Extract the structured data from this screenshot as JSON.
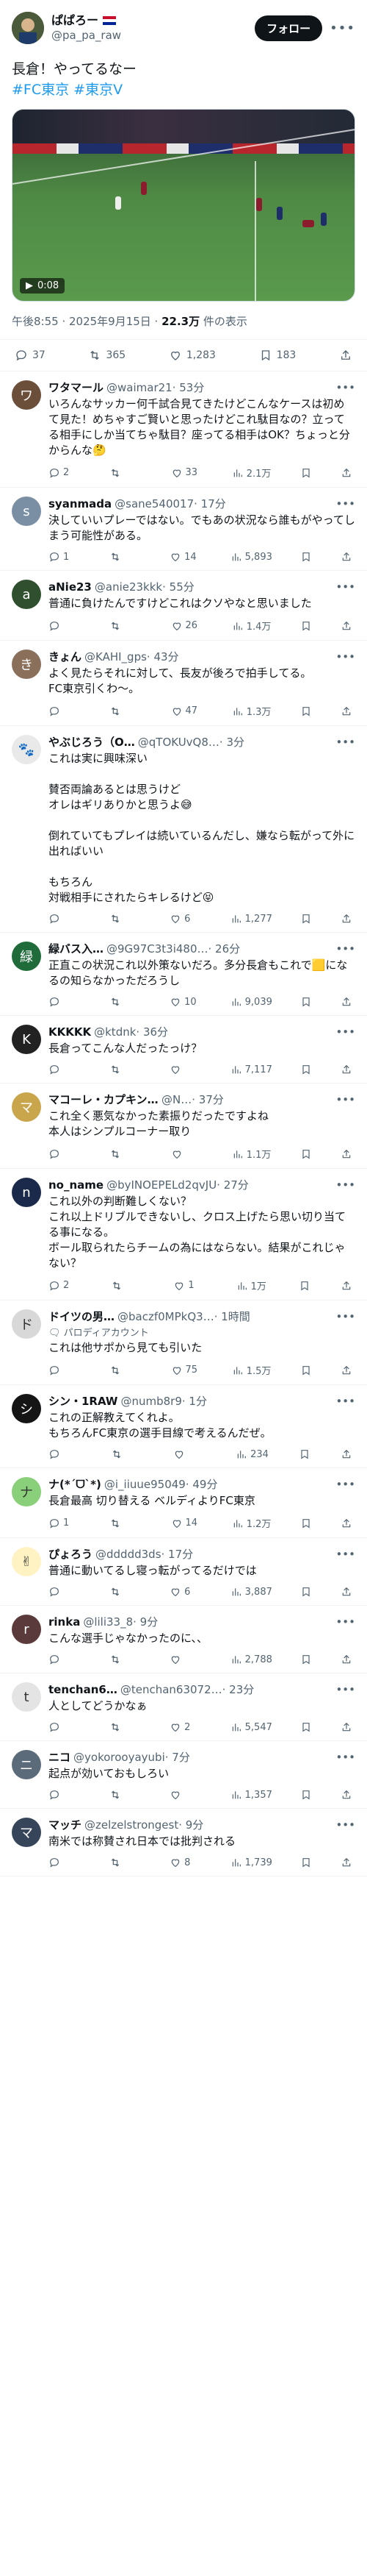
{
  "post": {
    "author_name": "ぱぱろー",
    "author_handle": "@pa_pa_raw",
    "follow_label": "フォロー",
    "text": "長倉！やってるなー",
    "hashtags": "#FC東京 #東京V",
    "video_time": "0:08",
    "timestamp": "午後8:55 · 2025年9月15日 · ",
    "views_count": "22.3万",
    "views_label": " 件の表示",
    "stats": {
      "replies": "37",
      "reposts": "365",
      "likes": "1,283",
      "bookmarks": "183"
    }
  },
  "replies": [
    {
      "name": "ワタマール",
      "handle": "@waimar21",
      "time": "· 53分",
      "text": "いろんなサッカー何千試合見てきたけどこんなケースは初めて見た！めちゃすご賢いと思ったけどこれ駄目なの？立ってる相手にしか当てちゃ駄目？座ってる相手はOK？ちょっと分からんな🤔",
      "replies": "2",
      "reposts": "",
      "likes": "33",
      "views": "2.1万",
      "avatar_color": "#6b4f3a",
      "avatar_char": "ワ"
    },
    {
      "name": "syanmada",
      "handle": "@sane540017",
      "time": "· 17分",
      "text": "決していいプレーではない。でもあの状況なら誰もがやってしまう可能性がある。",
      "replies": "1",
      "reposts": "",
      "likes": "14",
      "views": "5,893",
      "avatar_color": "#7a8fa3",
      "avatar_char": "s"
    },
    {
      "name": "aNie23",
      "handle": "@anie23kkk",
      "time": "· 55分",
      "text": "普通に負けたんですけどこれはクソやなと思いました",
      "replies": "",
      "reposts": "",
      "likes": "26",
      "views": "1.4万",
      "avatar_color": "#2f4f2f",
      "avatar_char": "a"
    },
    {
      "name": "きょん",
      "handle": "@KAHI_gps",
      "time": "· 43分",
      "text": "よく見たらそれに対して、長友が後ろで拍手してる。\nFC東京引くわ〜。",
      "replies": "",
      "reposts": "",
      "likes": "47",
      "views": "1.3万",
      "avatar_color": "#8a6f5a",
      "avatar_char": "き"
    },
    {
      "name": "やぶじろう（O…",
      "handle": "@qTOKUvQ8…",
      "time": "· 3分",
      "text": "これは実に興味深い\n\n賛否両論あるとは思うけど\nオレはギリありかと思うよ😅\n\n倒れていてもプレイは続いているんだし、嫌なら転がって外に出ればいい\n\nもちろん\n対戦相手にされたらキレるけど😝",
      "replies": "",
      "reposts": "",
      "likes": "6",
      "views": "1,277",
      "avatar_color": "#e9e9e9",
      "avatar_char": "🐾"
    },
    {
      "name": "緑バス入…",
      "handle": "@9G97C3t3i480…",
      "time": "· 26分",
      "text": "正直この状況これ以外策ないだろ。多分長倉もこれで🟨になるの知らなかっただろうし",
      "replies": "",
      "reposts": "",
      "likes": "10",
      "views": "9,039",
      "avatar_color": "#1f6b3a",
      "avatar_char": "緑"
    },
    {
      "name": "KKKKK",
      "handle": "@ktdnk",
      "time": "· 36分",
      "text": "長倉ってこんな人だったっけ？",
      "replies": "",
      "reposts": "",
      "likes": "",
      "views": "7,117",
      "avatar_color": "#222222",
      "avatar_char": "K"
    },
    {
      "name": "マコーレ・カプキン@投資…",
      "handle": "@N…",
      "time": "· 37分",
      "text": "これ全く悪気なかった素振りだったですよね\n本人はシンプルコーナー取り",
      "replies": "",
      "reposts": "",
      "likes": "",
      "views": "1.1万",
      "avatar_color": "#c9a64b",
      "avatar_char": "マ"
    },
    {
      "name": "no_name",
      "handle": "@byINOEPELd2qvJU",
      "time": "· 27分",
      "text": "これ以外の判断難しくない？\nこれ以上ドリブルできないし、クロス上げたら思い切り当てる事になる。\nボール取られたらチームの為にはならない。結果がこれじゃない？",
      "replies": "2",
      "reposts": "",
      "likes": "1",
      "views": "1万",
      "avatar_color": "#1b2a4a",
      "avatar_char": "n"
    },
    {
      "name": "ドイツの男…",
      "handle": "@baczf0MPkQ3…",
      "time": "· 1時間",
      "parody": "パロディアカウント",
      "text": "これは他サポから見ても引いた",
      "replies": "",
      "reposts": "",
      "likes": "75",
      "views": "1.5万",
      "avatar_color": "#d8d8d8",
      "avatar_char": "ド"
    },
    {
      "name": "シン・1RAW",
      "handle": "@numb8r9",
      "time": "· 1分",
      "text": "これの正解教えてくれよ。\nもちろんFC東京の選手目線で考えるんだぜ。",
      "replies": "",
      "reposts": "",
      "likes": "",
      "views": "234",
      "avatar_color": "#151515",
      "avatar_char": "シ"
    },
    {
      "name": "ナ(*ˊᗜˋ*)",
      "handle": "@i_iiuue95049",
      "time": "· 49分",
      "text": "長倉最高 切り替える ベルディよりFC東京",
      "replies": "1",
      "reposts": "",
      "likes": "14",
      "views": "1.2万",
      "avatar_color": "#8ad07a",
      "avatar_char": "ナ"
    },
    {
      "name": "ぴょろう",
      "handle": "@ddddd3ds",
      "time": "· 17分",
      "text": "普通に動いてるし寝っ転がってるだけでは",
      "replies": "",
      "reposts": "",
      "likes": "6",
      "views": "3,887",
      "avatar_color": "#fff3c4",
      "avatar_char": "✌"
    },
    {
      "name": "rinka",
      "handle": "@lili33_8",
      "time": "· 9分",
      "text": "こんな選手じゃなかったのに、、",
      "replies": "",
      "reposts": "",
      "likes": "",
      "views": "2,788",
      "avatar_color": "#5a3a3a",
      "avatar_char": "r"
    },
    {
      "name": "tenchan6…",
      "handle": "@tenchan63072…",
      "time": "· 23分",
      "text": "人としてどうかなぁ",
      "replies": "",
      "reposts": "",
      "likes": "2",
      "views": "5,547",
      "avatar_color": "#e4e4e4",
      "avatar_char": "t"
    },
    {
      "name": "ニコ",
      "handle": "@yokorooyayubi",
      "time": "· 7分",
      "text": "起点が効いておもしろい",
      "replies": "",
      "reposts": "",
      "likes": "",
      "views": "1,357",
      "avatar_color": "#5b6b7a",
      "avatar_char": "ニ"
    },
    {
      "name": "マッチ",
      "handle": "@zelzelstrongest",
      "time": "· 9分",
      "text": "南米では称賛され日本では批判される",
      "replies": "",
      "reposts": "",
      "likes": "8",
      "views": "1,739",
      "avatar_color": "#37455a",
      "avatar_char": "マ"
    }
  ],
  "colors": {
    "accent": "#1d9bf0",
    "text": "#0f1419",
    "muted": "#536471",
    "border": "#eff3f4"
  },
  "icons": {
    "reply": "comment-icon",
    "repost": "repost-icon",
    "like": "heart-icon",
    "views": "bar-chart-icon",
    "bookmark": "bookmark-icon",
    "share": "share-icon"
  }
}
